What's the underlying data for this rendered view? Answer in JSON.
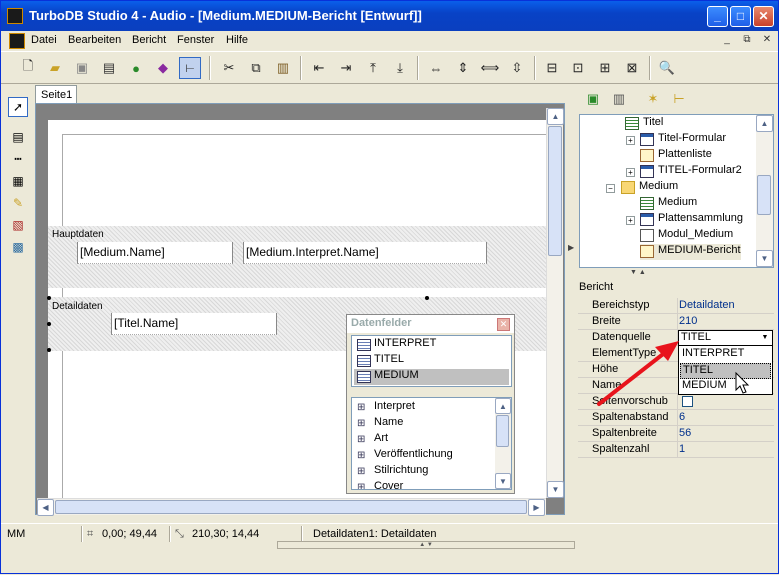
{
  "window": {
    "title": "TurboDB Studio 4 - Audio - [Medium.MEDIUM-Bericht [Entwurf]]",
    "min_label": "_",
    "max_label": "□",
    "close_label": "✕"
  },
  "menu": {
    "items": [
      "Datei",
      "Bearbeiten",
      "Bericht",
      "Fenster",
      "Hilfe"
    ],
    "mdi_min": "_",
    "mdi_restore": "⧉",
    "mdi_close": "✕"
  },
  "toolbar": {
    "icons": [
      "new-icon",
      "open-icon",
      "save-icon",
      "copy-db-icon",
      "globe-icon",
      "book-icon",
      "tree-icon",
      "cut-icon",
      "copy-icon",
      "paste-icon",
      "align-left-icon",
      "align-right-icon",
      "align-top-icon",
      "align-bottom-icon",
      "same-width-icon",
      "same-height-icon",
      "space-h-icon",
      "space-v-icon",
      "center-h-icon",
      "center-v-icon",
      "fit-h-icon",
      "fit-v-icon",
      "zoom-icon"
    ]
  },
  "designer": {
    "tab": "Seite1",
    "band_hauptdaten": "Hauptdaten",
    "band_detaildaten": "Detaildaten",
    "field_medium_name": "[Medium.Name]",
    "field_interpret_name": "[Medium.Interpret.Name]",
    "field_titel_name": "[Titel.Name]"
  },
  "datenfelder": {
    "title": "Datenfelder",
    "close_label": "✕",
    "tables": [
      "INTERPRET",
      "TITEL",
      "MEDIUM"
    ],
    "selected_table": "MEDIUM",
    "fields": [
      "Interpret",
      "Name",
      "Art",
      "Veröffentlichung",
      "Stilrichtung",
      "Cover"
    ]
  },
  "tree": {
    "nodes": [
      {
        "label": "Titel",
        "type": "table"
      },
      {
        "label": "Titel-Formular",
        "type": "form"
      },
      {
        "label": "Plattenliste",
        "type": "report"
      },
      {
        "label": "TITEL-Formular2",
        "type": "form"
      },
      {
        "label": "Medium",
        "type": "folder"
      },
      {
        "label": "Medium",
        "type": "table"
      },
      {
        "label": "Plattensammlung",
        "type": "form"
      },
      {
        "label": "Modul_Medium",
        "type": "module"
      },
      {
        "label": "MEDIUM-Bericht",
        "type": "report"
      }
    ]
  },
  "properties": {
    "header": "Bericht",
    "rows": [
      {
        "name": "Bereichstyp",
        "value": "Detaildaten"
      },
      {
        "name": "Breite",
        "value": "210"
      },
      {
        "name": "Datenquelle",
        "value": "TITEL"
      },
      {
        "name": "ElementType",
        "value": ""
      },
      {
        "name": "Höhe",
        "value": ""
      },
      {
        "name": "Name",
        "value": ""
      },
      {
        "name": "Seitenvorschub",
        "value": ""
      },
      {
        "name": "Spaltenabstand",
        "value": "6"
      },
      {
        "name": "Spaltenbreite",
        "value": "56"
      },
      {
        "name": "Spaltenzahl",
        "value": "1"
      }
    ],
    "dropdown_options": [
      "INTERPRET",
      "TITEL",
      "MEDIUM"
    ],
    "dropdown_hover": "TITEL",
    "annotation_color": "#E8141C"
  },
  "status": {
    "unit": "MM",
    "position": "0,00; 49,44",
    "size": "210,30; 14,44",
    "selection": "Detaildaten1: Detaildaten"
  }
}
